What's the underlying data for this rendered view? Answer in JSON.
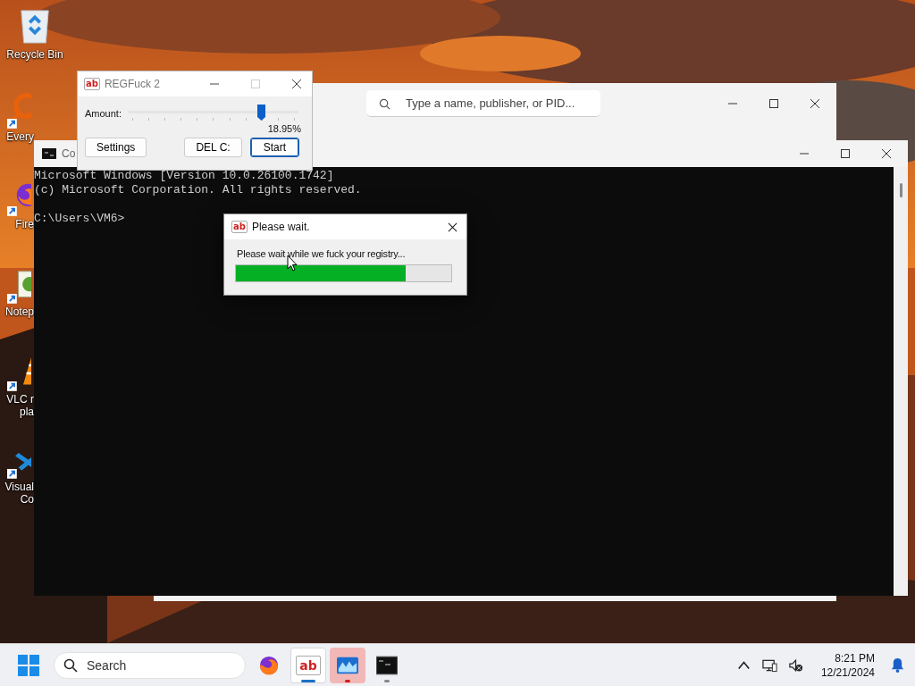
{
  "desktop": {
    "recycle_bin": {
      "label": "Recycle Bin"
    },
    "shortcuts": [
      {
        "kind": "everything",
        "label_lines": [
          "Every"
        ]
      },
      {
        "kind": "firefox",
        "label_lines": [
          "Fire"
        ]
      },
      {
        "kind": "notepad",
        "label_lines": [
          "Notep"
        ]
      },
      {
        "kind": "vlc",
        "label_lines": [
          "VLC r",
          "pla"
        ]
      },
      {
        "kind": "vscode",
        "label_lines": [
          "Visual",
          "Co"
        ]
      }
    ]
  },
  "task_manager": {
    "search": {
      "placeholder": "Type a name, publisher, or PID..."
    }
  },
  "console": {
    "title": "Co",
    "lines": [
      "Microsoft Windows [Version 10.0.26100.1742]",
      "(c) Microsoft Corporation. All rights reserved."
    ],
    "prompt": "C:\\Users\\VM6>"
  },
  "regfuck": {
    "icon_text": "ab",
    "title": "REGFuck 2",
    "maximize_disabled": true,
    "amount": {
      "label": "Amount:",
      "level": 0.78,
      "reading": "18.95%"
    },
    "buttons": [
      {
        "label": "Settings",
        "default": false
      },
      {
        "label": "DEL C:",
        "default": false
      },
      {
        "label": "Start",
        "default": true
      }
    ]
  },
  "progress_dialog": {
    "icon_text": "ab",
    "title": "Please wait.",
    "message": "Please wait while we fuck your registry...",
    "level": 0.79
  },
  "taskbar": {
    "search": {
      "placeholder": "Search"
    },
    "apps": [
      {
        "kind": "firefox",
        "running": false,
        "focused": false,
        "attention": false
      },
      {
        "kind": "regfuck",
        "icon_text": "ab",
        "running": true,
        "focused": true,
        "attention": false
      },
      {
        "kind": "task_manager",
        "running": true,
        "focused": false,
        "attention": true
      },
      {
        "kind": "terminal",
        "running": true,
        "focused": false,
        "attention": false
      }
    ],
    "clock": {
      "time": "8:21 PM",
      "date": "12/21/2024"
    }
  }
}
